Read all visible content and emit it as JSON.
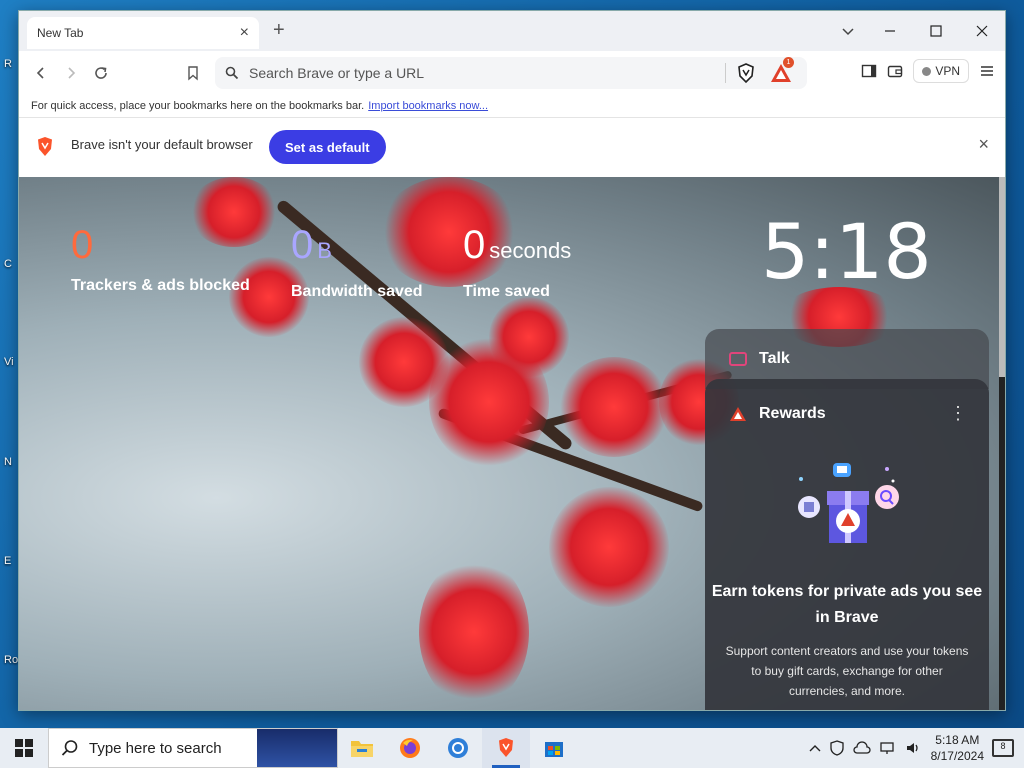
{
  "desktop": {
    "icon_labels": [
      "R",
      "C",
      "Vi",
      "N",
      "E",
      "Ro"
    ]
  },
  "browser": {
    "tab": {
      "title": "New Tab",
      "close": "×"
    },
    "new_tab": "+",
    "window_controls": {
      "minimize": "─",
      "maximize": "☐",
      "close": "✕",
      "tab_search": "⌄"
    },
    "address_bar": {
      "placeholder": "Search Brave or type a URL"
    },
    "rewards_badge": "1",
    "vpn_label": "VPN",
    "bookmarks_bar": {
      "text": "For quick access, place your bookmarks here on the bookmarks bar.",
      "link": "Import bookmarks now..."
    },
    "infobar": {
      "text": "Brave isn't your default browser",
      "button": "Set as default",
      "close": "×"
    }
  },
  "new_tab_page": {
    "stats": [
      {
        "value": "0",
        "unit": "",
        "label": "Trackers & ads blocked",
        "color": "#ff6a3d"
      },
      {
        "value": "0",
        "unit": "B",
        "label": "Bandwidth saved",
        "color": "#a9a6ff"
      },
      {
        "value": "0",
        "unit": "seconds",
        "label": "Time saved",
        "color": "#ffffff"
      }
    ],
    "clock": "5:18",
    "talk_widget": {
      "title": "Talk"
    },
    "rewards_widget": {
      "title": "Rewards",
      "menu": "⋮",
      "heading": "Earn tokens for private ads you see in Brave",
      "description": "Support content creators and use your tokens to buy gift cards, exchange for other currencies, and more."
    }
  },
  "taskbar": {
    "search_placeholder": "Type here to search",
    "time": "5:18 AM",
    "date": "8/17/2024",
    "notification_count": "8"
  },
  "colors": {
    "accent": "#3b3de4",
    "brave_orange": "#fb542b"
  }
}
